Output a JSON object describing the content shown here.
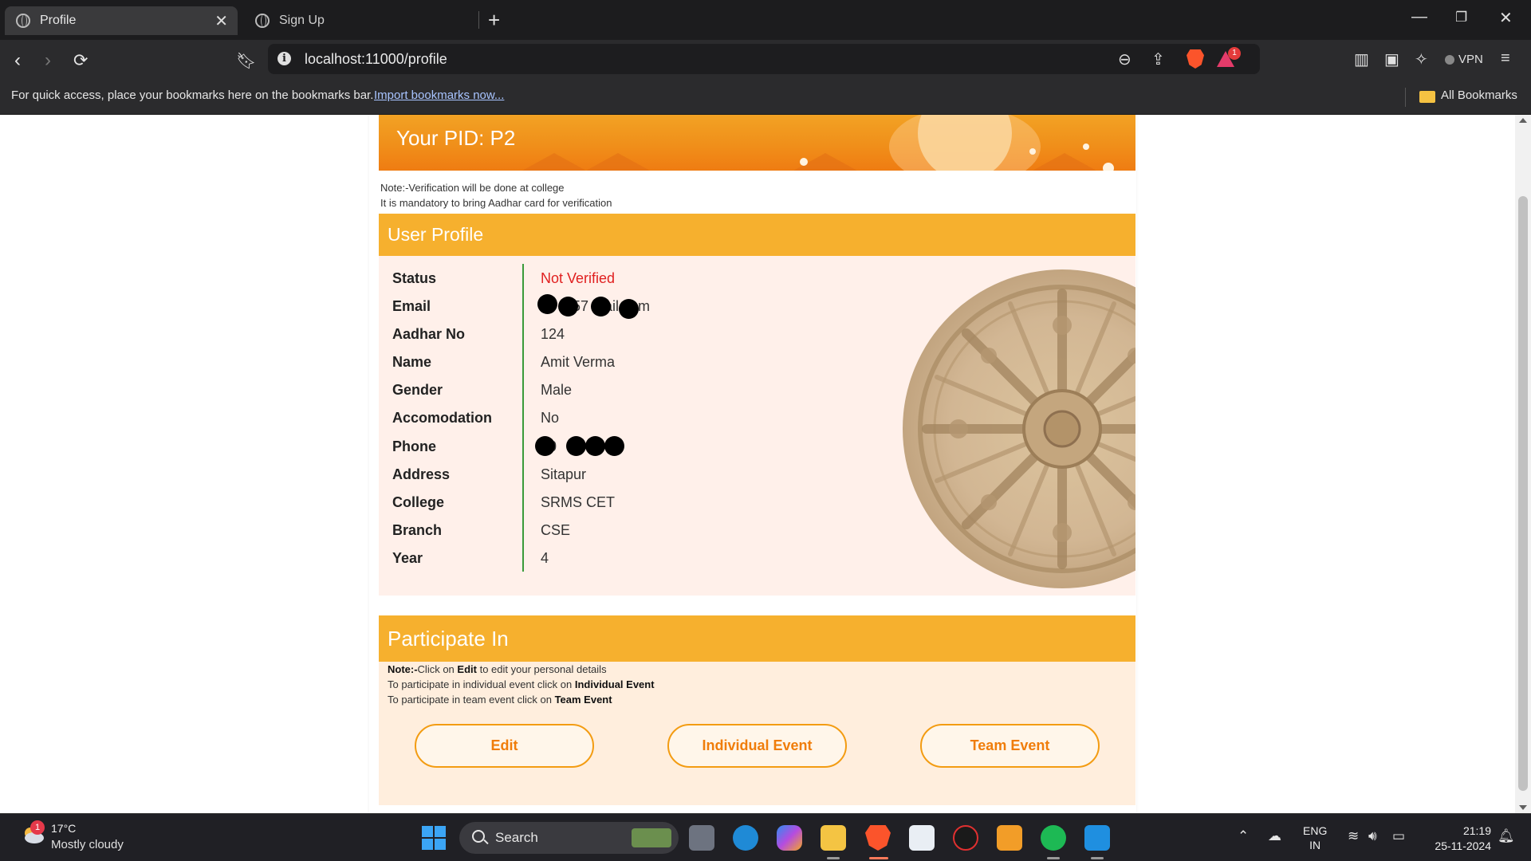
{
  "browser": {
    "tabs": [
      {
        "label": "Profile",
        "active": true
      },
      {
        "label": "Sign Up",
        "active": false
      }
    ],
    "url": "localhost:11000/profile",
    "vpn_label": "VPN",
    "rewards_badge": "1",
    "bookmarks_bar": {
      "message": "For quick access, place your bookmarks here on the bookmarks bar.",
      "import_link": "Import bookmarks now...",
      "all_bookmarks": "All Bookmarks"
    }
  },
  "page": {
    "pid_banner": "Your PID: P2",
    "notes": [
      "Note:-Verification will be done at college",
      "It is mandatory to bring Aadhar card for verification"
    ],
    "user_profile": {
      "title": "User Profile",
      "fields": [
        {
          "label": "Status",
          "value": "Not Verified",
          "highlight": true
        },
        {
          "label": "Email",
          "value": "57 g ail.com"
        },
        {
          "label": "Aadhar No",
          "value": "124"
        },
        {
          "label": "Name",
          "value": "Amit Verma"
        },
        {
          "label": "Gender",
          "value": "Male"
        },
        {
          "label": "Accomodation",
          "value": "No"
        },
        {
          "label": "Phone",
          "value": "0"
        },
        {
          "label": "Address",
          "value": "Sitapur"
        },
        {
          "label": "College",
          "value": "SRMS CET"
        },
        {
          "label": "Branch",
          "value": "CSE"
        },
        {
          "label": "Year",
          "value": "4"
        }
      ]
    },
    "participate": {
      "title": "Participate In",
      "note_1_prefix": "Note:-",
      "note_1_mid": "Click on ",
      "note_1_bold": "Edit",
      "note_1_suffix": " to edit your personal details",
      "note_2_prefix": "To participate in individual event click on ",
      "note_2_bold": "Individual Event",
      "note_3_prefix": "To participate in team event click on ",
      "note_3_bold": "Team Event",
      "buttons": [
        "Edit",
        "Individual Event",
        "Team Event"
      ]
    }
  },
  "taskbar": {
    "weather_badge": "1",
    "temperature": "17°C",
    "weather": "Mostly cloudy",
    "search_label": "Search",
    "lang_line1": "ENG",
    "lang_line2": "IN",
    "time": "21:19",
    "date": "25-11-2024"
  },
  "colors": {
    "accent_orange": "#f6b02e",
    "status_red": "#e02020",
    "button_text": "#f07d0a"
  }
}
